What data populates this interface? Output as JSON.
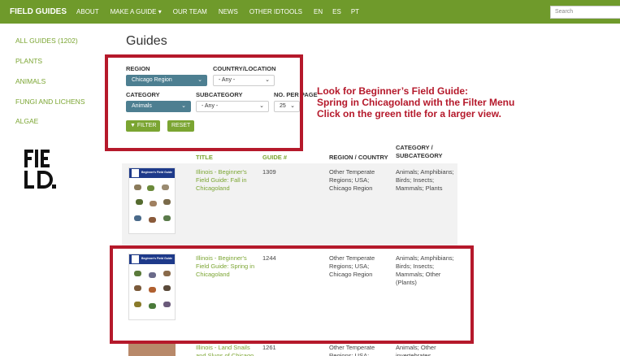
{
  "nav": {
    "brand": "FIELD GUIDES",
    "items": [
      "ABOUT",
      "MAKE A GUIDE ▾",
      "OUR TEAM",
      "NEWS",
      "OTHER IDTOOLS",
      "EN",
      "ES",
      "PT"
    ],
    "search_placeholder": "Search"
  },
  "sidebar": {
    "items": [
      "ALL GUIDES (1202)",
      "PLANTS",
      "ANIMALS",
      "FUNGI AND LICHENS",
      "ALGAE"
    ]
  },
  "page_title": "Guides",
  "filters": {
    "region_label": "REGION",
    "region_value": "Chicago Region",
    "country_label": "COUNTRY/LOCATION",
    "country_value": "- Any -",
    "category_label": "CATEGORY",
    "category_value": "Animals",
    "subcategory_label": "SUBCATEGORY",
    "subcategory_value": "- Any -",
    "perpage_label": "NO. PER PAGE",
    "perpage_value": "25",
    "filter_button": "▼ FILTER",
    "reset_button": "RESET"
  },
  "annotation": {
    "line1": "Look for Beginner’s Field Guide:",
    "line2": "Spring in Chicagoland with the Filter Menu",
    "line3": "Click on the green title for a larger view."
  },
  "table": {
    "headers": {
      "title": "TITLE",
      "guide": "GUIDE #",
      "region": "REGION / COUNTRY",
      "category": "CATEGORY / SUBCATEGORY"
    },
    "rows": [
      {
        "title": "Illinois - Beginner's Field Guide: Fall in Chicagoland",
        "guide": "1309",
        "region": "Other Temperate Regions; USA; Chicago Region",
        "category": "Animals; Amphibians; Birds; Insects; Mammals; Plants",
        "thumb_title": "Beginner's Field Guide"
      },
      {
        "title": "Illinois - Beginner's Field Guide: Spring in Chicagoland",
        "guide": "1244",
        "region": "Other Temperate Regions; USA; Chicago Region",
        "category": "Animals; Amphibians; Birds; Insects; Mammals; Other (Plants)",
        "thumb_title": "Beginner's Field Guide"
      },
      {
        "title": "Illinois - Land Snails and Slugs of Chicago",
        "guide": "1261",
        "region": "Other Temperate Regions; USA;",
        "category": "Animals; Other invertebrates"
      }
    ]
  },
  "colors": {
    "nav_green": "#6f9a2b",
    "link_green": "#7ba532",
    "annotation_red": "#b5192b",
    "select_teal": "#4d7f91"
  }
}
